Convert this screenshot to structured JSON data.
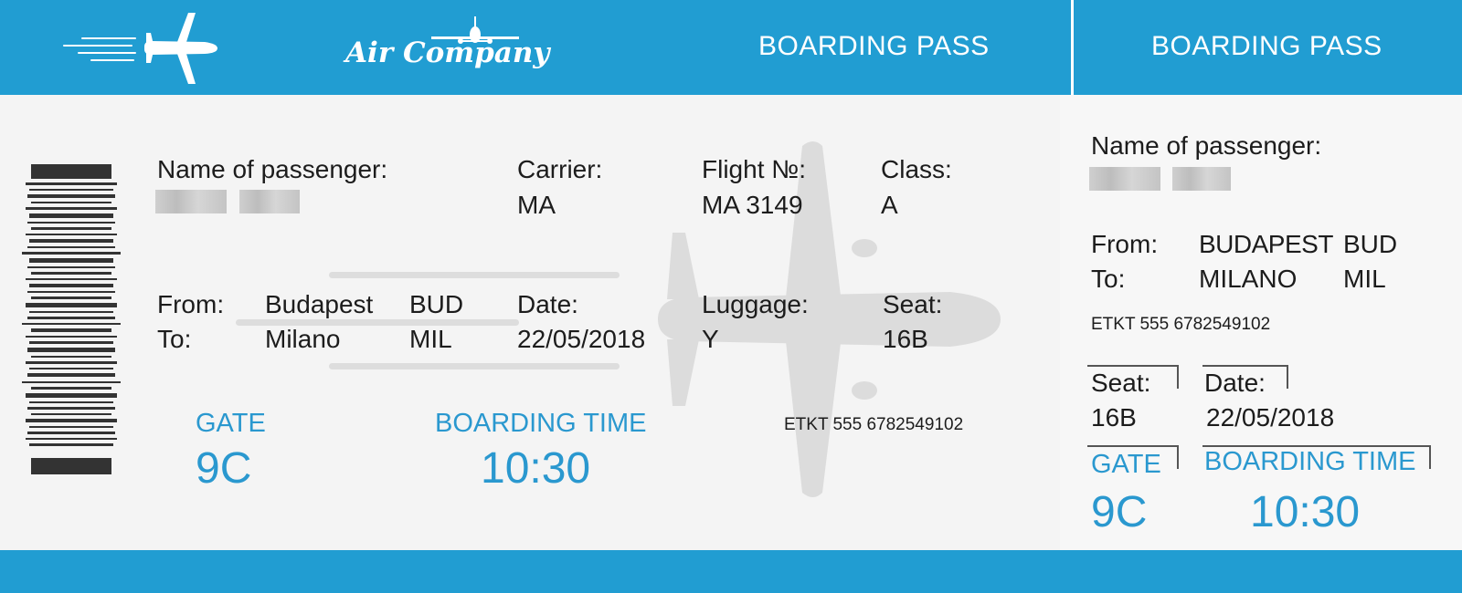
{
  "header": {
    "brand": "Air Company",
    "title_main": "BOARDING PASS",
    "title_stub": "BOARDING PASS"
  },
  "main": {
    "passenger_label": "Name of passenger:",
    "carrier_label": "Carrier:",
    "carrier_value": "MA",
    "flight_label": "Flight №:",
    "flight_value": "MA 3149",
    "class_label": "Class:",
    "class_value": "A",
    "from_label": "From:",
    "to_label": "To:",
    "from_city": "Budapest",
    "from_code": "BUD",
    "to_city": "Milano",
    "to_code": "MIL",
    "date_label": "Date:",
    "date_value": "22/05/2018",
    "luggage_label": "Luggage:",
    "luggage_value": "Y",
    "seat_label": "Seat:",
    "seat_value": "16B",
    "gate_label": "GATE",
    "gate_value": "9C",
    "boarding_label": "BOARDING TIME",
    "boarding_value": "10:30",
    "eticket": "ETKT 555 6782549102"
  },
  "stub": {
    "passenger_label": "Name of passenger:",
    "from_label": "From:",
    "to_label": "To:",
    "from_city": "BUDAPEST",
    "from_code": "BUD",
    "to_city": "MILANO",
    "to_code": "MIL",
    "eticket": "ETKT 555 6782549102",
    "seat_label": "Seat:",
    "seat_value": "16B",
    "date_label": "Date:",
    "date_value": "22/05/2018",
    "gate_label": "GATE",
    "gate_value": "9C",
    "boarding_label": "BOARDING TIME",
    "boarding_value": "10:30"
  },
  "colors": {
    "brand_blue": "#219dd2",
    "accent_text": "#2a98cf",
    "background": "#f4f4f4"
  },
  "icons": [
    "plane-icon",
    "barcode-icon",
    "plane-watermark-icon"
  ]
}
